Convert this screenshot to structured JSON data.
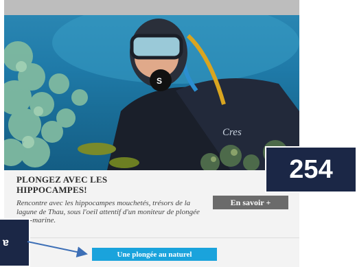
{
  "card": {
    "title": "PLONGEZ AVEC LES HIPPOCAMPES!",
    "description": "Rencontre avec les hippocampes mouchetés, trésors de la lagune de Thau, sous l'oeil attentif d'un moniteur de plongée sous-marine.",
    "more_button": "En savoir +",
    "cta_button": "Une plongée au naturel",
    "wetsuit_brand": "Cres"
  },
  "annotations": {
    "badge_number": "254",
    "left_box_text": "ɐ"
  },
  "colors": {
    "badge_bg": "#1b2746",
    "cta_bg": "#1aa3dc",
    "more_bg": "#6b6b6b",
    "arrow": "#3d6fb6"
  }
}
